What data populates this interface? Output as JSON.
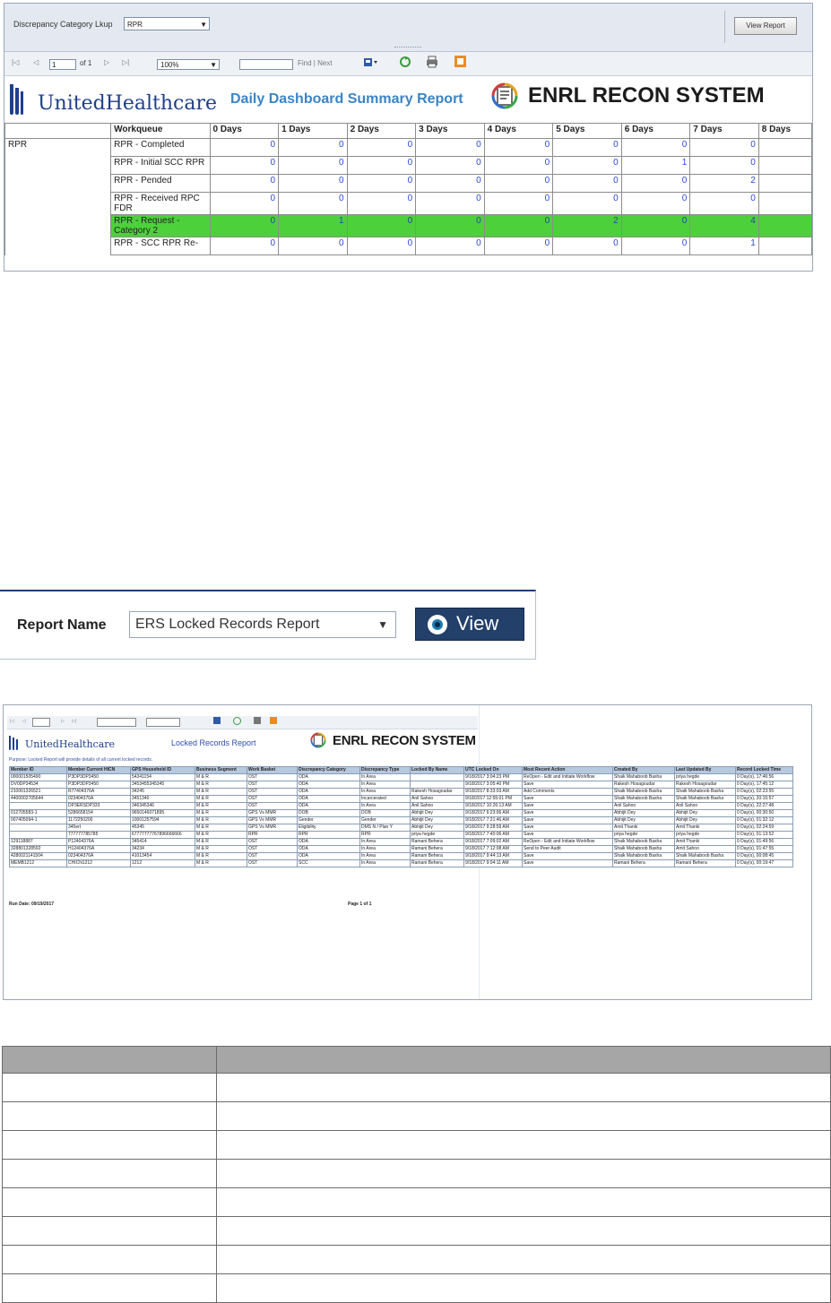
{
  "dashboard": {
    "param_label": "Discrepancy Category Lkup",
    "param_value": "RPR",
    "view_report_button": "View Report",
    "toolbar": {
      "first": "|◁",
      "prev": "◁",
      "page": "1",
      "of_pages": "of 1",
      "next": "▷",
      "last": "▷|",
      "zoom": "100%",
      "find_next": "Find | Next"
    },
    "brand": "UnitedHealthcare",
    "report_title": "Daily Dashboard Summary Report",
    "system_name": "ENRL RECON SYSTEM",
    "grid": {
      "headers": [
        "",
        "Workqueue",
        "0 Days",
        "1 Days",
        "2 Days",
        "3 Days",
        "4 Days",
        "5 Days",
        "6 Days",
        "7 Days",
        "8 Days"
      ],
      "group": "RPR",
      "rows": [
        {
          "name": "RPR - Completed",
          "values": [
            "0",
            "0",
            "0",
            "0",
            "0",
            "0",
            "0",
            "0",
            ""
          ]
        },
        {
          "name": "RPR - Initial SCC RPR",
          "values": [
            "0",
            "0",
            "0",
            "0",
            "0",
            "0",
            "1",
            "0",
            ""
          ]
        },
        {
          "name": "RPR - Pended",
          "values": [
            "0",
            "0",
            "0",
            "0",
            "0",
            "0",
            "0",
            "2",
            ""
          ]
        },
        {
          "name": "RPR - Received RPC FDR",
          "values": [
            "0",
            "0",
            "0",
            "0",
            "0",
            "0",
            "0",
            "0",
            ""
          ]
        },
        {
          "name": "RPR - Request - Category 2",
          "values": [
            "0",
            "1",
            "0",
            "0",
            "0",
            "2",
            "0",
            "4",
            ""
          ],
          "highlight": true
        },
        {
          "name": "RPR - SCC RPR Re-",
          "values": [
            "0",
            "0",
            "0",
            "0",
            "0",
            "0",
            "0",
            "1",
            ""
          ]
        }
      ]
    }
  },
  "report_selector": {
    "label": "Report Name",
    "selected": "ERS Locked Records Report",
    "button": "View"
  },
  "locked_report": {
    "brand": "UnitedHealthcare",
    "title": "Locked Records Report",
    "system_name": "ENRL RECON SYSTEM",
    "purpose": "Purpose: Locked Report will provide details of all current locked records.",
    "columns": [
      "Member ID",
      "Member Current HICN",
      "GPS Household ID",
      "Business Segment",
      "Work Basket",
      "Discrepancy Category",
      "Discrepancy Type",
      "Locked By Name",
      "UTC Locked On",
      "Most Recent Action",
      "Created By",
      "Last Updated By",
      "Record Locked Time"
    ],
    "rows": [
      [
        "000001505490",
        "P3DP3DP3450",
        "54341154",
        "M & R",
        "OST",
        "ODA",
        "In Area",
        "",
        "9/18/2017 3:04:23 PM",
        "ReOpen - Edit and Initiate Workflow",
        "Shaik Mahaboob Basha",
        "priya hegde",
        "0 Day(s), 17:46:56"
      ],
      [
        "DV0DP34534",
        "P3DP3DP3450",
        "3453455345345",
        "M & R",
        "OST",
        "ODA",
        "In Area",
        "",
        "9/18/2017 3:05:40 PM",
        "Save",
        "Rakesh Hosagoudar",
        "Rakesh Hosagoudar",
        "0 Day(s), 17:45:12"
      ],
      [
        "210001326521",
        "R77404376A",
        "34245",
        "M & R",
        "OST",
        "ODA",
        "In Area",
        "Rakesh Hosagoudar",
        "9/18/2017 8:33:03 AM",
        "Add Comments",
        "Shaik Mahaboob Basha",
        "Shaik Mahaboob Basha",
        "0 Day(s), 02:23:55"
      ],
      [
        "4400002705644",
        "023404376A",
        "3451340",
        "M & R",
        "OST",
        "ODA",
        "Incarcerated",
        "Anil Sahoo",
        "9/18/2017 12:55:01 PM",
        "Save",
        "Shaik Mahaboob Basha",
        "Shaik Mahaboob Basha",
        "0 Day(s), 20:15:57"
      ],
      [
        "",
        "DP3ERSDP333",
        "346345346",
        "M & R",
        "OST",
        "ODA",
        "In Area",
        "Anil Sahoo",
        "9/18/2017 10:26:13 AM",
        "Save",
        "Anil Sahoo",
        "Anil Sahoo",
        "0 Day(s), 22:27:48"
      ],
      [
        "012705583-1",
        "5286658154",
        "9650146071895",
        "M & R",
        "GPS Vs MMR",
        "DOB",
        "DOB",
        "Abhijit Dey",
        "9/18/2017 6:23:06 AM",
        "Save",
        "Abhijit Dey",
        "Abhijit Dey",
        "0 Day(s), 00:30:50"
      ],
      [
        "007405094-1",
        "1172250200",
        "10001257594",
        "M & R",
        "GPS Vs MMR",
        "Gender",
        "Gender",
        "Abhijit Dey",
        "9/18/2017 7:21:46 AM",
        "Save",
        "Abhijit Dey",
        "Abhijit Dey",
        "0 Day(s), 01:32:12"
      ],
      [
        "",
        "345ert",
        "45345",
        "M & R",
        "GPS Vs MMR",
        "Eligibility",
        "DMS N / Plan Y",
        "Abhijit Dey",
        "9/18/2017 9:28:59 AM",
        "Save",
        "Amit Thanki",
        "Amit Thanki",
        "0 Day(s), 02:24:59"
      ],
      [
        "",
        "777777785785",
        "67777777767896666666",
        "M & R",
        "RPR",
        "RPR",
        "RPR",
        "priya hegde",
        "9/18/2017 7:40:06 AM",
        "Save",
        "priya hegde",
        "priya hegde",
        "0 Day(s), 01:13:52"
      ],
      [
        "129118887",
        "P12404376A",
        "345414",
        "M & R",
        "OST",
        "ODA",
        "In Area",
        "Ramani Behera",
        "9/18/2017 7:09:02 AM",
        "ReOpen - Edit and Initiate Workflow",
        "Shaik Mahaboob Basha",
        "Amit Thanki",
        "0 Day(s), 01:49:56"
      ],
      [
        "328801328592",
        "H12404376A",
        "34234",
        "M & R",
        "OST",
        "ODA",
        "In Area",
        "Ramani Behera",
        "9/18/2017 7:12:08 AM",
        "Send to Peer Audit",
        "Shaik Mahaboob Basha",
        "Amit Sahoo",
        "0 Day(s), 01:47:55"
      ],
      [
        "4280021141504",
        "023404376A",
        "41013454",
        "M & R",
        "OST",
        "ODA",
        "In Area",
        "Ramani Behera",
        "9/18/2017 9:44:13 AM",
        "Save",
        "Shaik Mahaboob Basha",
        "Shaik Mahaboob Basha",
        "0 Day(s), 00:08:45"
      ],
      [
        "MEMB1212",
        "CHICN1212",
        "1212",
        "M & R",
        "OST",
        "SCC",
        "In Area",
        "Ramani Behera",
        "9/18/2017 9:04:11 AM",
        "Save",
        "Ramani Behera",
        "Ramani Behera",
        "0 Day(s), 00:19:47"
      ]
    ],
    "run_date": "Run Date: 09/19/2017",
    "page_info": "Page 1 of 1"
  },
  "colors": {
    "highlight_row": "#4cd13b",
    "value_blue": "#2b4ad8",
    "brand_navy": "#1e3f8c",
    "view_button": "#23406a",
    "grid_header": "#b7c9df",
    "blank_header": "#a6a6a6"
  }
}
